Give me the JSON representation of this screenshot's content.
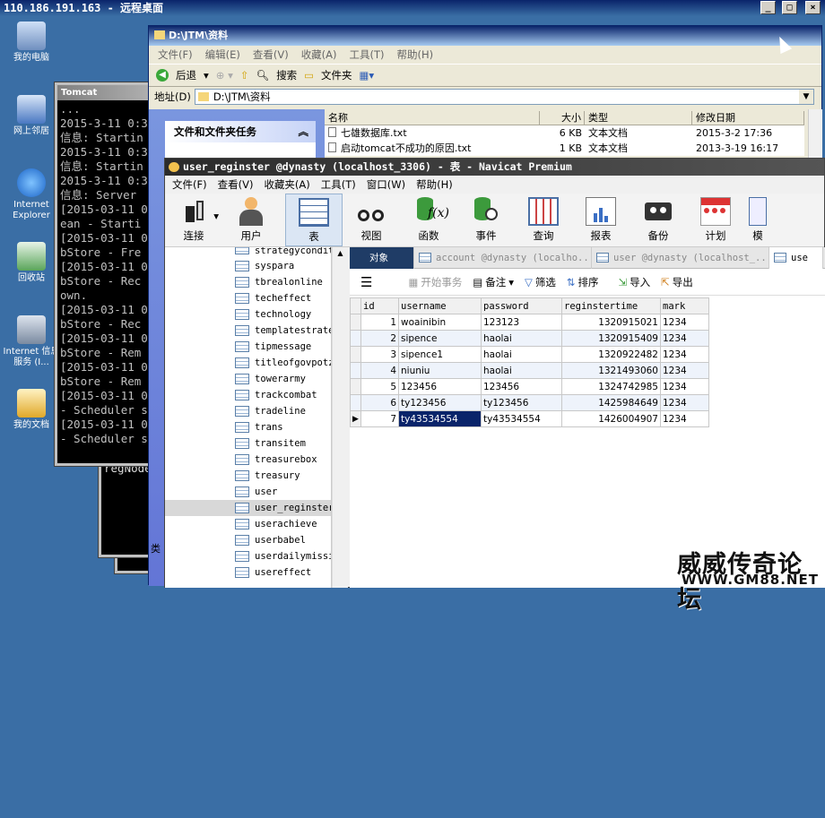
{
  "rdp": {
    "title": "110.186.191.163 - 远程桌面",
    "min": "_",
    "max": "□",
    "close": "×"
  },
  "desktop": {
    "icons": [
      {
        "label": "我的电脑"
      },
      {
        "label": "网上邻居"
      },
      {
        "label": "Internet Explorer"
      },
      {
        "label": "回收站"
      },
      {
        "label": "Internet 信息服务 (I..."
      },
      {
        "label": "我的文档"
      }
    ]
  },
  "cmd": {
    "title": "Tomcat",
    "back_lines": [
      "regNode",
      "...",
      "...",
      "..."
    ],
    "lines": [
      "...",
      "2015-3-11 0:3",
      "信息: Startin",
      "2015-3-11 0:3",
      "信息: Startin",
      "2015-3-11 0:3",
      "信息: Server",
      "[2015-03-11 0",
      "ean  - Starti",
      "[2015-03-11 0",
      "bStore  - Fre",
      "[2015-03-11 0",
      "bStore  - Rec",
      "own.",
      "[2015-03-11 0",
      "bStore  - Rec",
      "[2015-03-11 0",
      "bStore  - Rem",
      "[2015-03-11 0",
      "bStore  - Rem",
      "[2015-03-11 0",
      "- Scheduler s",
      "[2015-03-11 0",
      "- Scheduler s"
    ]
  },
  "explorer": {
    "title": "D:\\JTM\\资料",
    "menu": [
      "文件(F)",
      "编辑(E)",
      "查看(V)",
      "收藏(A)",
      "工具(T)",
      "帮助(H)"
    ],
    "back": "后退",
    "search": "搜索",
    "folders": "文件夹",
    "address_label": "地址(D)",
    "address": "D:\\JTM\\资料",
    "task_title": "文件和文件夹任务",
    "cols": [
      "名称",
      "大小",
      "类型",
      "修改日期"
    ],
    "files": [
      {
        "name": "七雄数据库.txt",
        "size": "6 KB",
        "type": "文本文档",
        "date": "2015-3-2 17:36"
      },
      {
        "name": "启动tomcat不成功的原因.txt",
        "size": "1 KB",
        "type": "文本文档",
        "date": "2013-3-19 16:17"
      }
    ],
    "status": "类"
  },
  "navicat": {
    "title": "user_reginster @dynasty (localhost_3306) - 表 - Navicat Premium",
    "menu": [
      "文件(F)",
      "查看(V)",
      "收藏夹(A)",
      "工具(T)",
      "窗口(W)",
      "帮助(H)"
    ],
    "toolbar": [
      "连接",
      "用户",
      "表",
      "视图",
      "函数",
      "事件",
      "查询",
      "报表",
      "备份",
      "计划",
      "模"
    ],
    "tables": [
      "strategycondit",
      "syspara",
      "tbrealonline",
      "techeffect",
      "technology",
      "templatestrate",
      "tipmessage",
      "titleofgovpotz",
      "towerarmy",
      "trackcombat",
      "tradeline",
      "trans",
      "transitem",
      "treasurebox",
      "treasury",
      "user",
      "user_reginster",
      "userachieve",
      "userbabel",
      "userdailymissi",
      "usereffect"
    ],
    "tabs": [
      "对象",
      "account @dynasty (localho...",
      "user @dynasty (localhost_...",
      "use"
    ],
    "subtools": [
      "开始事务",
      "备注",
      "筛选",
      "排序",
      "导入",
      "导出"
    ],
    "grid": {
      "headers": [
        "id",
        "username",
        "password",
        "reginstertime",
        "mark"
      ],
      "rows": [
        [
          "1",
          "woainibin",
          "123123",
          "1320915021",
          "1234"
        ],
        [
          "2",
          "sipence",
          "haolai",
          "1320915409",
          "1234"
        ],
        [
          "3",
          "sipence1",
          "haolai",
          "1320922482",
          "1234"
        ],
        [
          "4",
          "niuniu",
          "haolai",
          "1321493060",
          "1234"
        ],
        [
          "5",
          "123456",
          "123456",
          "1324742985",
          "1234"
        ],
        [
          "6",
          "ty123456",
          "ty123456",
          "1425984649",
          "1234"
        ],
        [
          "7",
          "ty43534554",
          "ty43534554",
          "1426004907",
          "1234"
        ]
      ]
    }
  },
  "watermark": {
    "line1": "威威传奇论坛",
    "line2": "WWW.GM88.NET"
  }
}
